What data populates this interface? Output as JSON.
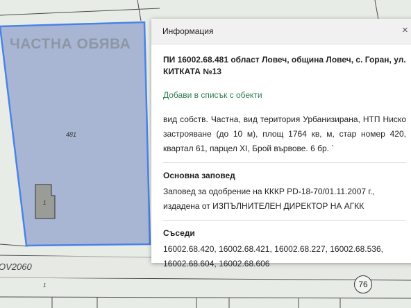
{
  "map": {
    "watermark": "ЧАСТНА ОБЯВА",
    "parcel_number": "481",
    "building_number": "1",
    "road_label": "OV2060",
    "small_label": "1",
    "circle_label": "76"
  },
  "popup": {
    "title": "Информация",
    "close_glyph": "×",
    "address": "ПИ 16002.68.481 област Ловеч, община Ловеч, с. Горан, ул. КИТКАТА №13",
    "add_link": "Добави в списък с обекти",
    "description": "вид собств. Частна, вид територия Урбанизирана, НТП Ниско застрояване (до 10 м), площ 1764 кв, м, стар номер 420, квартал 61, парцел XI, Брой вървове. 6 бр. `",
    "order_heading": "Основна заповед",
    "order_text": "Заповед за одобрение на КККР РD-18-70/01.11.2007 г., издадена от ИЗПЪЛНИТЕЛЕН ДИРЕКТОР НА АГКК",
    "neighbors_heading": "Съседи",
    "neighbors_text": "16002.68.420, 16002.68.421, 16002.68.227, 16002.68.536, 16002.68.604, 16002.68.606"
  },
  "colors": {
    "parcel_fill": "#a9b6d3",
    "parcel_border": "#4a82e8",
    "link": "#2d7a4e"
  }
}
